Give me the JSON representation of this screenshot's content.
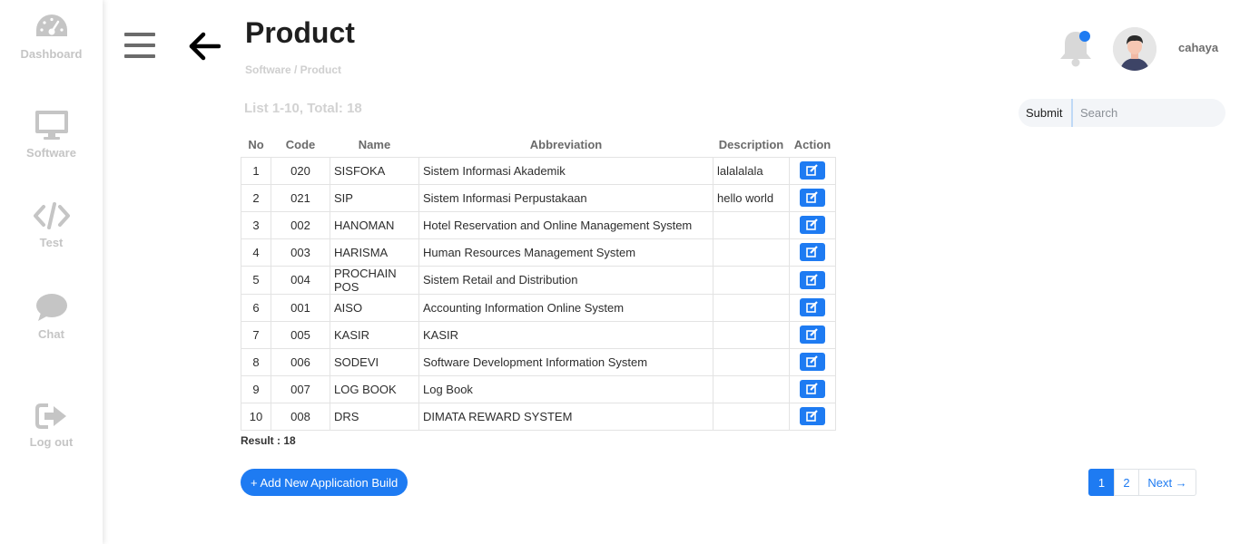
{
  "sidebar": {
    "items": [
      {
        "label": "Dashboard",
        "icon": "gauge-icon"
      },
      {
        "label": "Software",
        "icon": "monitor-icon"
      },
      {
        "label": "Test",
        "icon": "code-icon"
      },
      {
        "label": "Chat",
        "icon": "chat-bubble-icon"
      },
      {
        "label": "Log out",
        "icon": "logout-icon"
      }
    ]
  },
  "header": {
    "title": "Product",
    "breadcrumb": "Software / Product",
    "username": "cahaya"
  },
  "list_info": "List 1-10, Total: 18",
  "search": {
    "submit_label": "Submit",
    "placeholder": "Search"
  },
  "table": {
    "columns": [
      "No",
      "Code",
      "Name",
      "Abbreviation",
      "Description",
      "Action"
    ],
    "rows": [
      {
        "no": "1",
        "code": "020",
        "name": "SISFOKA",
        "abbreviation": "Sistem Informasi Akademik",
        "description": "lalalalala"
      },
      {
        "no": "2",
        "code": "021",
        "name": "SIP",
        "abbreviation": "Sistem Informasi Perpustakaan",
        "description": "hello world"
      },
      {
        "no": "3",
        "code": "002",
        "name": "HANOMAN",
        "abbreviation": "Hotel Reservation and Online Management System",
        "description": ""
      },
      {
        "no": "4",
        "code": "003",
        "name": "HARISMA",
        "abbreviation": "Human Resources Management System",
        "description": ""
      },
      {
        "no": "5",
        "code": "004",
        "name": "PROCHAIN POS",
        "abbreviation": "Sistem Retail and Distribution",
        "description": ""
      },
      {
        "no": "6",
        "code": "001",
        "name": "AISO",
        "abbreviation": "Accounting Information Online System",
        "description": ""
      },
      {
        "no": "7",
        "code": "005",
        "name": "KASIR",
        "abbreviation": "KASIR",
        "description": ""
      },
      {
        "no": "8",
        "code": "006",
        "name": "SODEVI",
        "abbreviation": "Software Development Information System",
        "description": ""
      },
      {
        "no": "9",
        "code": "007",
        "name": "LOG BOOK",
        "abbreviation": "Log Book",
        "description": ""
      },
      {
        "no": "10",
        "code": "008",
        "name": "DRS",
        "abbreviation": "DIMATA REWARD SYSTEM",
        "description": ""
      }
    ]
  },
  "result_text": "Result : 18",
  "add_button_label": "+ Add New Application Build",
  "pagination": {
    "pages": [
      "1",
      "2"
    ],
    "active_page": "1",
    "next_label": "Next →"
  },
  "colors": {
    "accent": "#1e7bf2",
    "sidebar_icon": "#c5c5c5",
    "notification_dot": "#1e7bf2"
  }
}
